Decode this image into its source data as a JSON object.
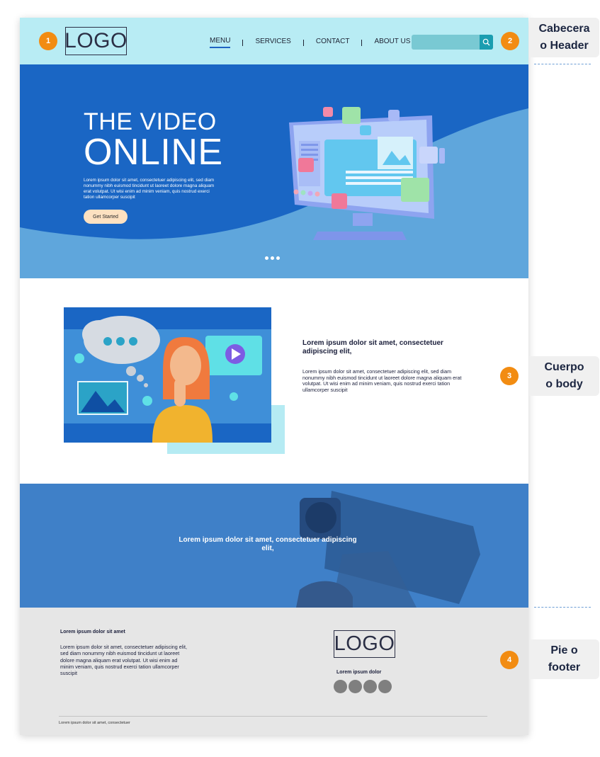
{
  "header": {
    "badge": "1",
    "logo": "LOGO",
    "nav": [
      "MENU",
      "SERVICES",
      "CONTACT",
      "ABOUT US"
    ],
    "search_badge": "2"
  },
  "hero": {
    "title_line1": "THE VIDEO",
    "title_line2": "ONLINE",
    "text": "Lorem ipsum dolor sit amet, consectetuer adipiscing elit, sed diam nonummy nibh euismod tincidunt ut laoreet dolore magna aliquam erat volutpat. Ut wisi enim ad minim veniam, quis nostrud exerci tation ullamcorper suscipit",
    "cta": "Get Started"
  },
  "feature": {
    "title": "Lorem ipsum dolor sit amet, consectetuer adipiscing elit,",
    "text": "Lorem ipsum dolor sit amet, consectetuer adipiscing elit, sed diam nonummy nibh euismod tincidunt ut laoreet dolore magna aliquam erat volutpat. Ut wisi enim ad minim veniam, quis nostrud exerci tation ullamcorper suscipit"
  },
  "banner": {
    "text": "Lorem ipsum dolor sit amet, consectetuer adipiscing elit,"
  },
  "footer": {
    "title": "Lorem ipsum dolor sit amet",
    "text": "Lorem ipsum dolor sit amet, consectetuer adipiscing elit, sed diam nonummy nibh euismod tincidunt ut laoreet dolore magna aliquam erat volutpat. Ut wisi enim ad minim veniam, quis nostrud exerci tation ullamcorper suscipit",
    "logo": "LOGO",
    "logo_caption": "Lorem ipsum dolor",
    "copyright": "Lorem ipsum dolor sit amet, consectetuer"
  },
  "annotations": {
    "header_label_1": "Cabecera",
    "header_label_2": "o Header",
    "body_badge": "3",
    "body_label_1": "Cuerpo",
    "body_label_2": "o body",
    "footer_badge": "4",
    "footer_label_1": "Pie o",
    "footer_label_2": "footer"
  },
  "colors": {
    "header_bg": "#b8ecf4",
    "hero_dark": "#1a66c4",
    "hero_light": "#5fa6dc",
    "badge": "#f28c12",
    "cta_bg": "#fde1c1",
    "footer_bg": "#e6e6e6"
  }
}
